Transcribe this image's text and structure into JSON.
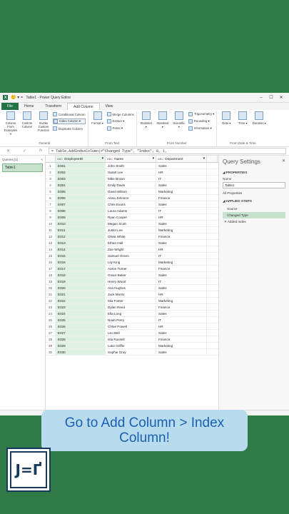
{
  "window": {
    "app_icon": "X",
    "quick_access": "🙂 ▾  =",
    "title": "Table1 - Power Query Editor",
    "controls": [
      "–",
      "☐",
      "✕"
    ]
  },
  "tabs": [
    "File",
    "Home",
    "Transform",
    "Add Column",
    "View"
  ],
  "active_tab": "Add Column",
  "ribbon": {
    "general": {
      "label": "General",
      "buttons": [
        "Column From Examples ▾",
        "Custom Column",
        "Invoke Custom Function"
      ],
      "small": [
        "Conditional Column",
        "Index Column ▾",
        "Duplicate Column"
      ]
    },
    "from_text": {
      "label": "From Text",
      "buttons": [
        "Format ▾"
      ],
      "small": [
        "Merge Columns",
        "Extract ▾",
        "Parse ▾"
      ],
      "small_icons": [
        "ABC",
        "ABC",
        "ABC"
      ]
    },
    "from_number": {
      "label": "From Number",
      "buttons": [
        "Statistics ▾",
        "Standard ▾",
        "Scientific ▾"
      ],
      "small": [
        "Trigonometry ▾",
        "Rounding ▾",
        "Information ▾"
      ]
    },
    "from_date_time": {
      "label": "From Date & Time",
      "buttons": [
        "Date ▾",
        "Time ▾",
        "Duration ▾"
      ]
    }
  },
  "formula_bar": {
    "buttons": [
      "✕",
      "✓",
      "fx"
    ],
    "text": "= Table.AddIndexColumn(#\"Changed Type\", \"Index\", 0, 1,"
  },
  "queries": {
    "header": "Queries [1]",
    "collapse": "<",
    "items": [
      "Table1"
    ]
  },
  "columns": [
    {
      "type": "ABC",
      "name": "EmployeeID"
    },
    {
      "type": "ABC",
      "name": "Name"
    },
    {
      "type": "ABC",
      "name": "Department"
    }
  ],
  "rows": [
    [
      "E001",
      "John Smith",
      "Sales"
    ],
    [
      "E002",
      "Sarah Lee",
      "HR"
    ],
    [
      "E003",
      "Mike Brown",
      "IT"
    ],
    [
      "E004",
      "Emily Davis",
      "Sales"
    ],
    [
      "E005",
      "David Wilson",
      "Marketing"
    ],
    [
      "E006",
      "Anna Johnson",
      "Finance"
    ],
    [
      "E007",
      "Chris Evans",
      "Sales"
    ],
    [
      "E008",
      "Laura Adams",
      "IT"
    ],
    [
      "E009",
      "Ryan Cooper",
      "HR"
    ],
    [
      "E010",
      "Megan Scott",
      "Sales"
    ],
    [
      "E011",
      "Justin Lee",
      "Marketing"
    ],
    [
      "E012",
      "Olivia White",
      "Finance"
    ],
    [
      "E013",
      "Ethan Hall",
      "Sales"
    ],
    [
      "E014",
      "Zoe Wright",
      "HR"
    ],
    [
      "E015",
      "Samuel Green",
      "IT"
    ],
    [
      "E016",
      "Lily King",
      "Marketing"
    ],
    [
      "E017",
      "Aaron Turner",
      "Finance"
    ],
    [
      "E018",
      "Grace Baker",
      "Sales"
    ],
    [
      "E019",
      "Henry Wood",
      "IT"
    ],
    [
      "E020",
      "Ava Hughes",
      "Sales"
    ],
    [
      "E021",
      "Jack Morris",
      "HR"
    ],
    [
      "E022",
      "Mia Foster",
      "Marketing"
    ],
    [
      "E023",
      "Dylan Reed",
      "Finance"
    ],
    [
      "E024",
      "Ella Long",
      "Sales"
    ],
    [
      "E025",
      "Noah Perry",
      "IT"
    ],
    [
      "E026",
      "Chloe Powell",
      "HR"
    ],
    [
      "E027",
      "Leo Bell",
      "Sales"
    ],
    [
      "E028",
      "Isla Russell",
      "Finance"
    ],
    [
      "E029",
      "Luke Griffin",
      "Marketing"
    ],
    [
      "E030",
      "Sophie Gray",
      "Sales"
    ]
  ],
  "settings": {
    "title": "Query Settings",
    "close": "✕",
    "properties_header": "◢ PROPERTIES",
    "name_label": "Name",
    "name_value": "Table1",
    "all_properties": "All Properties",
    "steps_header": "◢ APPLIED STEPS",
    "steps": [
      "Source",
      "Changed Type",
      "✕ Added Index"
    ]
  },
  "caption": {
    "line1": "Go to Add Column > Index",
    "line2": "Column!"
  },
  "logo": {
    "text": "J=Ґ"
  },
  "colors": {
    "background": "#2f7a47",
    "excel_green": "#217346",
    "caption_bg": "#b8dcee",
    "caption_text": "#1a5fb4",
    "selection": "#c6e2cd"
  }
}
